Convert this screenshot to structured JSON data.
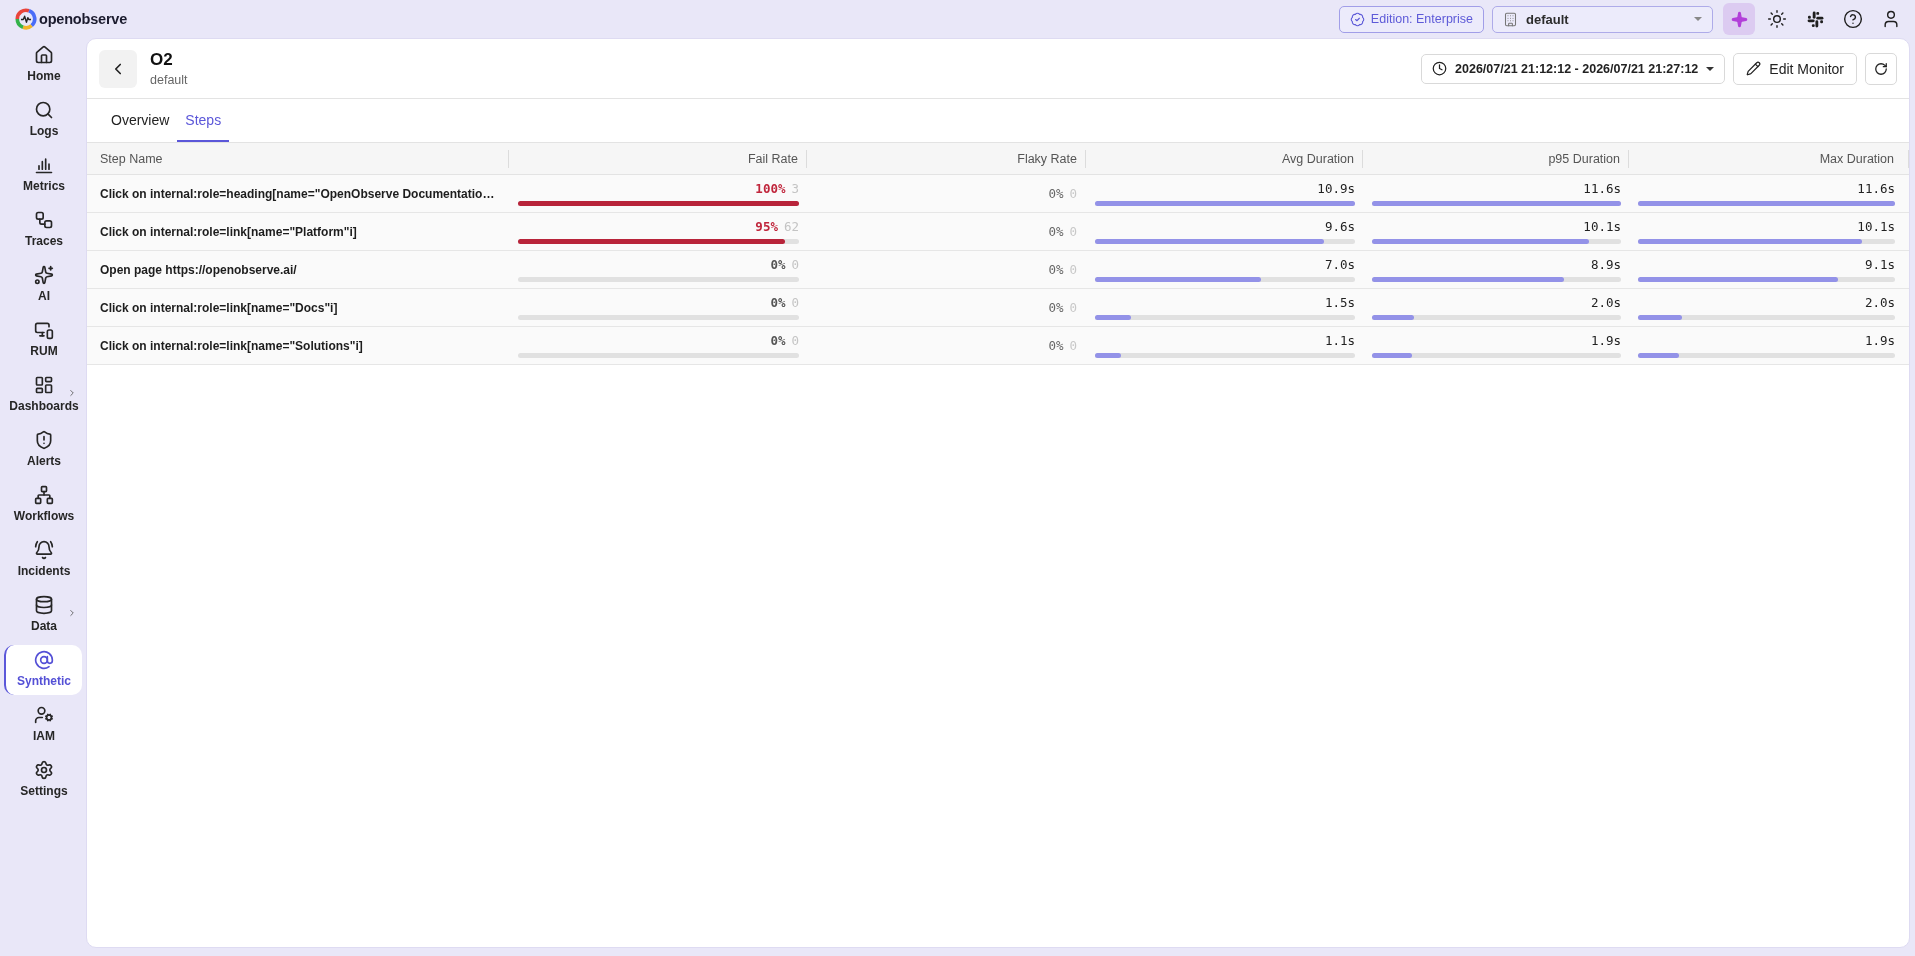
{
  "brand": {
    "name": "openobserve"
  },
  "topbar": {
    "edition_badge": "Edition: Enterprise",
    "org_select": {
      "value": "default"
    }
  },
  "sidebar": {
    "items": [
      {
        "label": "Home",
        "selected": false,
        "has_submenu": false
      },
      {
        "label": "Logs",
        "selected": false,
        "has_submenu": false
      },
      {
        "label": "Metrics",
        "selected": false,
        "has_submenu": false
      },
      {
        "label": "Traces",
        "selected": false,
        "has_submenu": false
      },
      {
        "label": "AI",
        "selected": false,
        "has_submenu": false
      },
      {
        "label": "RUM",
        "selected": false,
        "has_submenu": false
      },
      {
        "label": "Dashboards",
        "selected": false,
        "has_submenu": true
      },
      {
        "label": "Alerts",
        "selected": false,
        "has_submenu": false
      },
      {
        "label": "Workflows",
        "selected": false,
        "has_submenu": false
      },
      {
        "label": "Incidents",
        "selected": false,
        "has_submenu": false
      },
      {
        "label": "Data",
        "selected": false,
        "has_submenu": true
      },
      {
        "label": "Synthetic",
        "selected": true,
        "has_submenu": false
      },
      {
        "label": "IAM",
        "selected": false,
        "has_submenu": false
      },
      {
        "label": "Settings",
        "selected": false,
        "has_submenu": false
      }
    ]
  },
  "header": {
    "title": "O2",
    "subtitle": "default",
    "time_range": "2026/07/21 21:12:12 - 2026/07/21 21:27:12",
    "edit_button": "Edit Monitor"
  },
  "tabs": [
    {
      "label": "Overview",
      "selected": false
    },
    {
      "label": "Steps",
      "selected": true
    }
  ],
  "table": {
    "columns": [
      "Step Name",
      "Fail Rate",
      "Flaky Rate",
      "Avg Duration",
      "p95 Duration",
      "Max Duration"
    ],
    "rows": [
      {
        "step_name": "Click on internal:role=heading[name=\"OpenObserve Documentatio…",
        "fail_rate": {
          "value": "100%",
          "count": "3",
          "level": 1
        },
        "flaky_rate": {
          "value": "0%",
          "count": "0"
        },
        "avg_duration": {
          "value": "10.9s",
          "level": 1
        },
        "p95_duration": {
          "value": "11.6s",
          "level": 1
        },
        "max_duration": {
          "value": "11.6s",
          "level": 1
        }
      },
      {
        "step_name": "Click on internal:role=link[name=\"Platform\"i]",
        "fail_rate": {
          "value": "95%",
          "count": "62",
          "level": 0.95
        },
        "flaky_rate": {
          "value": "0%",
          "count": "0"
        },
        "avg_duration": {
          "value": "9.6s",
          "level": 0.88
        },
        "p95_duration": {
          "value": "10.1s",
          "level": 0.87
        },
        "max_duration": {
          "value": "10.1s",
          "level": 0.87
        }
      },
      {
        "step_name": "Open page https://openobserve.ai/",
        "fail_rate": {
          "value": "0%",
          "count": "0"
        },
        "flaky_rate": {
          "value": "0%",
          "count": "0"
        },
        "avg_duration": {
          "value": "7.0s",
          "level": 0.64
        },
        "p95_duration": {
          "value": "8.9s",
          "level": 0.77
        },
        "max_duration": {
          "value": "9.1s",
          "level": 0.78
        }
      },
      {
        "step_name": "Click on internal:role=link[name=\"Docs\"i]",
        "fail_rate": {
          "value": "0%",
          "count": "0"
        },
        "flaky_rate": {
          "value": "0%",
          "count": "0"
        },
        "avg_duration": {
          "value": "1.5s",
          "level": 0.14
        },
        "p95_duration": {
          "value": "2.0s",
          "level": 0.17
        },
        "max_duration": {
          "value": "2.0s",
          "level": 0.17
        }
      },
      {
        "step_name": "Click on internal:role=link[name=\"Solutions\"i]",
        "fail_rate": {
          "value": "0%",
          "count": "0"
        },
        "flaky_rate": {
          "value": "0%",
          "count": "0"
        },
        "avg_duration": {
          "value": "1.1s",
          "level": 0.1
        },
        "p95_duration": {
          "value": "1.9s",
          "level": 0.16
        },
        "max_duration": {
          "value": "1.9s",
          "level": 0.16
        }
      }
    ]
  }
}
